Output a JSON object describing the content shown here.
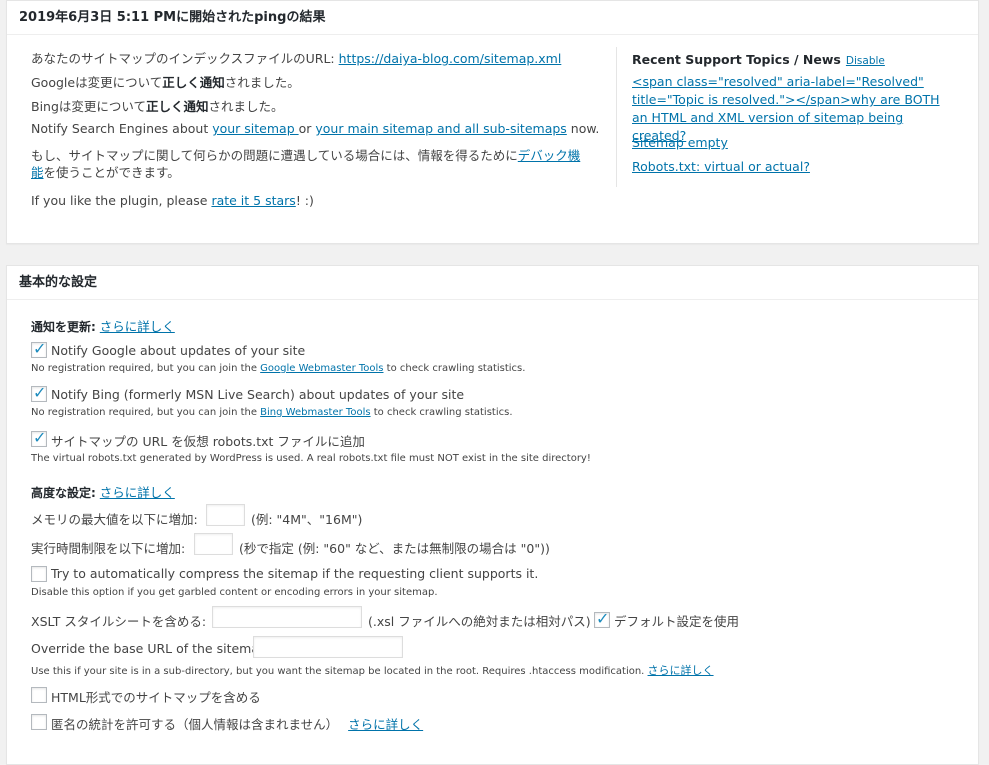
{
  "ping_panel": {
    "title": "2019年6月3日 5:11 PMに開始されたpingの結果",
    "line1_text": "あなたのサイトマップのインデックスファイルのURL: ",
    "line1_link": "https://daiya-blog.com/sitemap.xml",
    "line2_pre": "Googleは変更について",
    "line2_bold": "正しく通知",
    "line2_post": "されました。",
    "line3_pre": "Bingは変更について",
    "line3_bold": "正しく通知",
    "line3_post": "されました。",
    "line4_pre": "Notify Search Engines about ",
    "line4_link1": "your sitemap ",
    "line4_mid": "or ",
    "line4_link2": "your main sitemap and all sub-sitemaps",
    "line4_post": " now.",
    "line5_pre": "もし、サイトマップに関して何らかの問題に遭遇している場合には、情報を得るために",
    "line5_link_a": "デバック機",
    "line5_link_b": "能",
    "line5_post": "を使うことができます。",
    "line6_pre": "If you like the plugin, please ",
    "line6_link": "rate it 5 stars",
    "line6_post": "! :)"
  },
  "sidebar": {
    "title": "Recent Support Topics / News",
    "disable_link": "Disable",
    "topic1": "<span class=\"resolved\" aria-label=\"Resolved\" title=\"Topic is resolved.\"></span>why are BOTH an HTML and XML version of sitemap being created?",
    "topic2": "Sitemap empty",
    "topic3": "Robots.txt: virtual or actual?"
  },
  "basic_panel": {
    "title": "基本的な設定",
    "notify_label": "通知を更新:",
    "notify_more": "さらに詳しく",
    "google_label": "Notify Google about updates of your site",
    "google_help_pre": "No registration required, but you can join the ",
    "google_help_link": "Google Webmaster Tools",
    "google_help_post": " to check crawling statistics.",
    "bing_label": "Notify Bing (formerly MSN Live Search) about updates of your site",
    "bing_help_pre": "No registration required, but you can join the ",
    "bing_help_link": "Bing Webmaster Tools",
    "bing_help_post": " to check crawling statistics.",
    "robots_label": "サイトマップの URL を仮想 robots.txt ファイルに追加",
    "robots_help": "The virtual robots.txt generated by WordPress is used. A real robots.txt file must NOT exist in the site directory!",
    "advanced_label": "高度な設定:",
    "advanced_more": "さらに詳しく",
    "memory_label": "メモリの最大値を以下に増加:",
    "memory_example": "(例: \"4M\"、\"16M\")",
    "time_label": "実行時間制限を以下に増加:",
    "time_example": "(秒で指定 (例: \"60\" など、または無制限の場合は \"0\"))",
    "compress_label": "Try to automatically compress the sitemap if the requesting client supports it.",
    "compress_help": "Disable this option if you get garbled content or encoding errors in your sitemap.",
    "xslt_label": "XSLT スタイルシートを含める:",
    "xslt_hint": "(.xsl ファイルへの絶対または相対パス)",
    "xslt_default_label": "デフォルト設定を使用",
    "baseurl_label": "Override the base URL of the sitemap:",
    "baseurl_help": "Use this if your site is in a sub-directory, but you want the sitemap be located in the root. Requires .htaccess modification.",
    "baseurl_more": "さらに詳しく",
    "html_label": "HTML形式でのサイトマップを含める",
    "stats_label": "匿名の統計を許可する（個人情報は含まれません）",
    "stats_more": "さらに詳しく",
    "checkmark": "✓"
  }
}
